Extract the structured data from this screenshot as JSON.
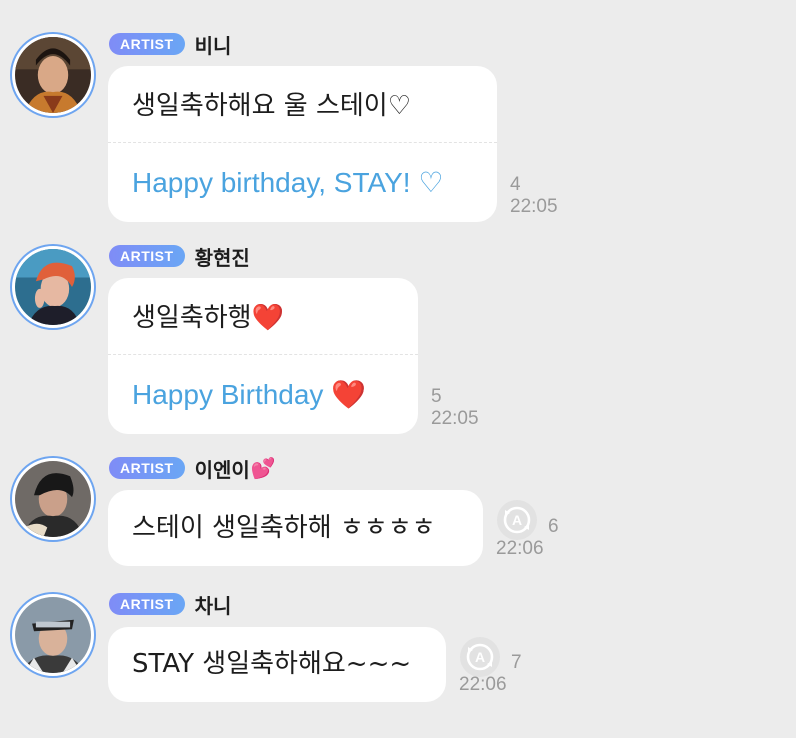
{
  "badge_label": "ARTIST",
  "messages": [
    {
      "sender": "비니",
      "text": "생일축하해요 울 스테이♡",
      "translation": "Happy birthday, STAY! ♡",
      "count": "4",
      "time": "22:05"
    },
    {
      "sender": "황현진",
      "text": "생일축하행❤️",
      "translation": "Happy Birthday ❤️",
      "count": "5",
      "time": "22:05"
    },
    {
      "sender": "이엔이",
      "sender_emoji": "💕",
      "text": "스테이 생일축하해 ㅎㅎㅎㅎ",
      "count": "6",
      "time": "22:06"
    },
    {
      "sender": "차니",
      "text": "STAY 생일축하해요~~~",
      "count": "7",
      "time": "22:06"
    }
  ],
  "colors": {
    "background": "#ececec",
    "bubble": "#ffffff",
    "translation_text": "#4aa3df",
    "badge_start": "#7f8cf6",
    "badge_end": "#6aa6f5",
    "avatar_ring": "#6ea5f0",
    "meta_text": "#9a9a9a"
  },
  "icons": {
    "translate": "translate-a-icon"
  }
}
